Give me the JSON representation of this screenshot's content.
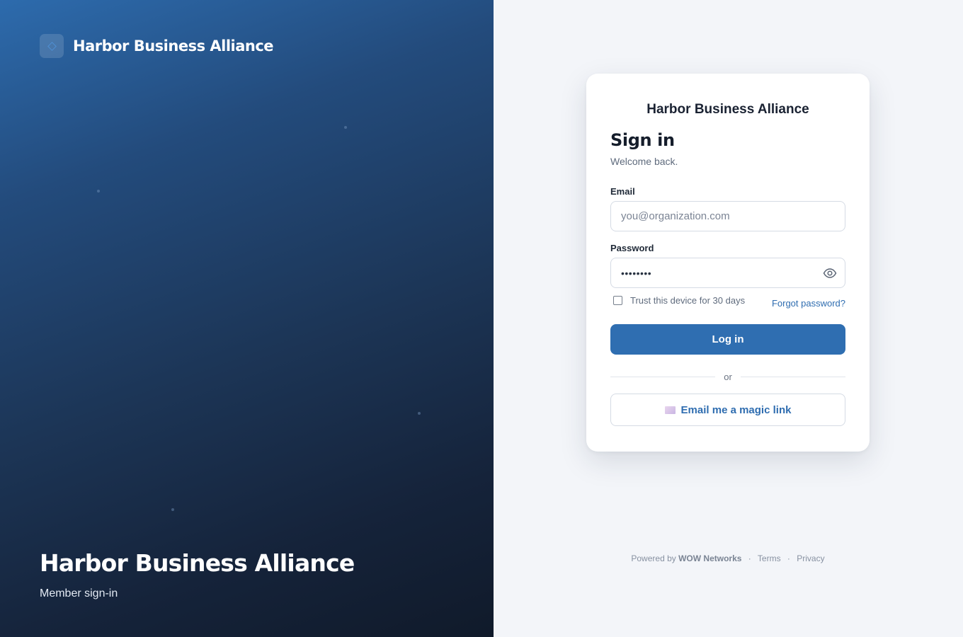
{
  "hero": {
    "brand_name": "Harbor Business Alliance",
    "title": "Harbor Business Alliance",
    "subtitle": "Member sign-in"
  },
  "card": {
    "org_name": "Harbor Business Alliance",
    "heading": "Sign in",
    "welcome": "Welcome back.",
    "email": {
      "label": "Email",
      "placeholder": "you@organization.com",
      "value": ""
    },
    "password": {
      "label": "Password",
      "masked_value": "••••••••"
    },
    "trust_label": "Trust this device for 30 days",
    "trust_checked": false,
    "forgot_label": "Forgot password?",
    "login_label": "Log in",
    "divider_text": "or",
    "magic_label": "Email me a magic link"
  },
  "footer": {
    "powered_prefix": "Powered by",
    "powered_brand": "WOW Networks",
    "separator": "·",
    "terms": "Terms",
    "privacy": "Privacy"
  },
  "icons": {
    "logo": "diamond-logo-icon",
    "password_toggle": "eye-icon",
    "magic_link": "envelope-icon"
  },
  "colors": {
    "accent": "#2f6eb1",
    "link": "#2f6db0",
    "hero_gradient_start": "#2d6bad",
    "hero_gradient_end": "#101a2a",
    "page_background": "#f3f5f9"
  }
}
